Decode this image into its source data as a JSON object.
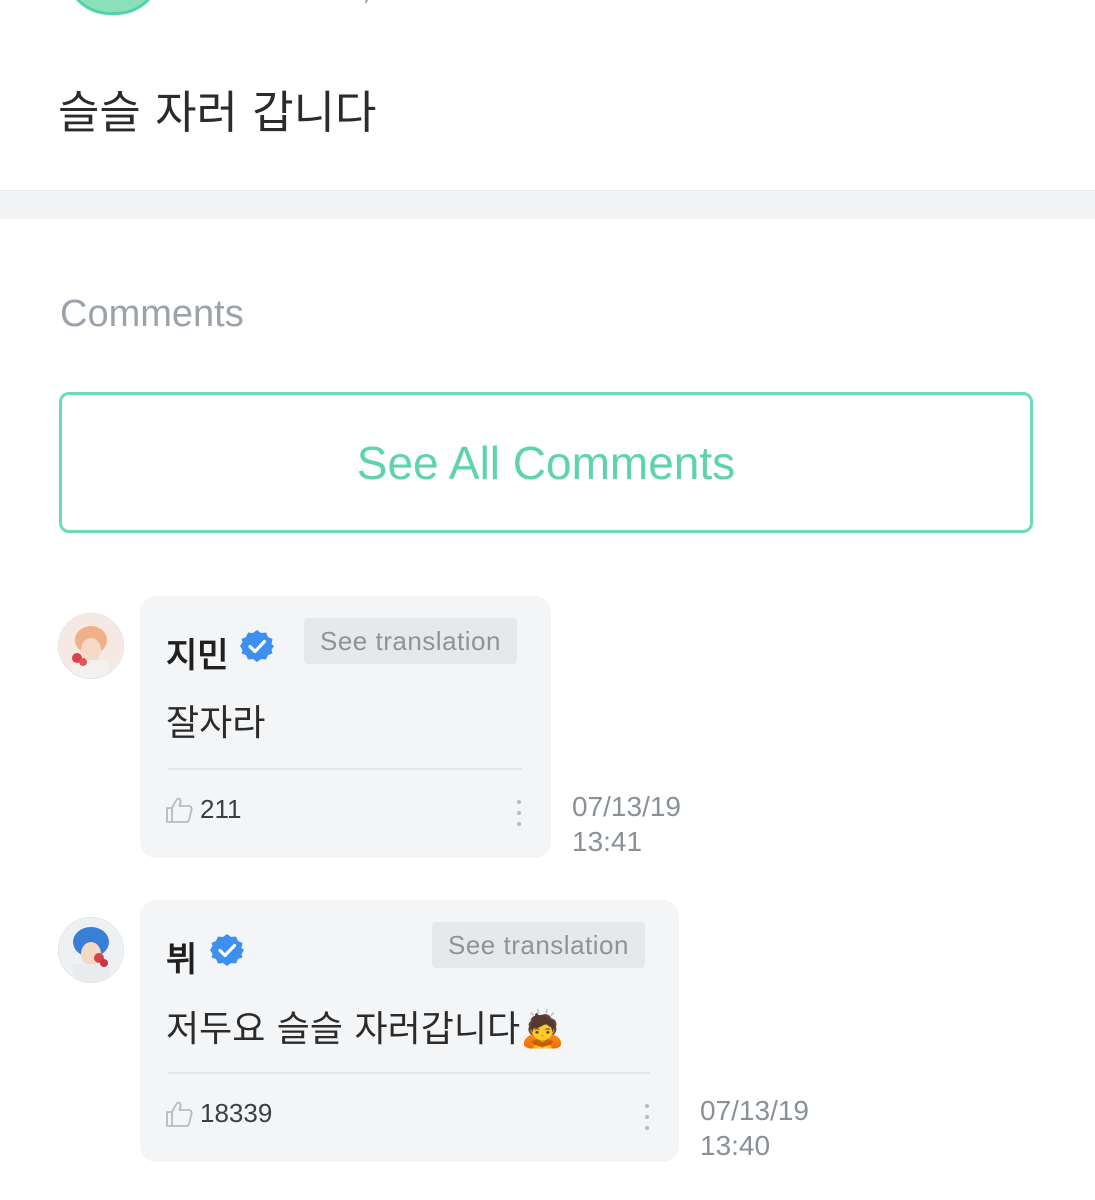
{
  "post": {
    "text": "슬슬 자러 갑니다"
  },
  "comments_section": {
    "heading": "Comments",
    "see_all_label": "See All Comments"
  },
  "comments": [
    {
      "author": "지민",
      "verified": true,
      "translate_label": "See translation",
      "text": "잘자라",
      "likes": "211",
      "date": "07/13/19",
      "time": "13:41"
    },
    {
      "author": "뷔",
      "verified": true,
      "translate_label": "See translation",
      "text": "저두요 슬슬 자러갑니다",
      "emoji": "🙇",
      "likes": "18339",
      "date": "07/13/19",
      "time": "13:40"
    }
  ],
  "colors": {
    "accent": "#5ed3ae",
    "verified_blue": "#3d8ff0",
    "bubble_bg": "#f3f5f7"
  },
  "icons": [
    "verified-badge-icon",
    "thumbs-up-icon",
    "more-vertical-icon"
  ]
}
